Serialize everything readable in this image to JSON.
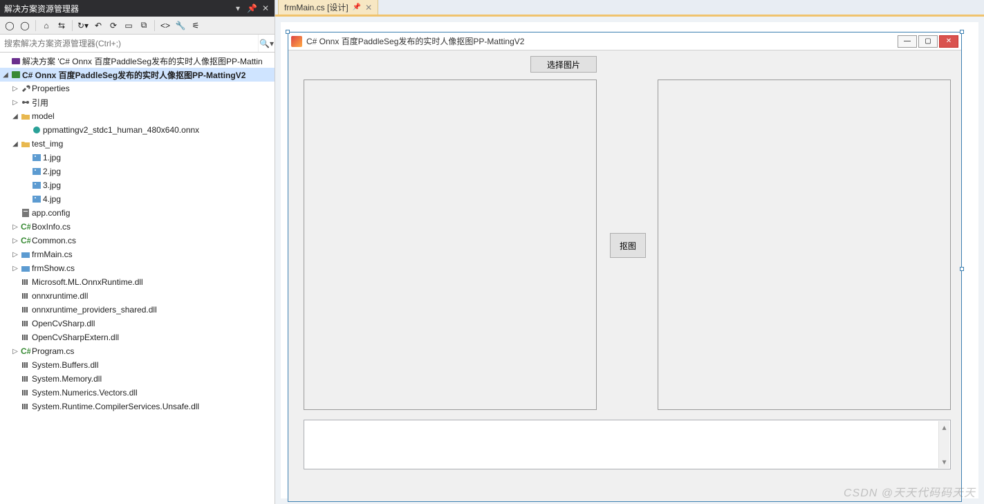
{
  "panel": {
    "title": "解决方案资源管理器",
    "search_placeholder": "搜索解决方案资源管理器(Ctrl+;)"
  },
  "tree": {
    "solution": "解决方案 'C# Onnx 百度PaddleSeg发布的实时人像抠图PP-Mattin",
    "project": "C# Onnx 百度PaddleSeg发布的实时人像抠图PP-MattingV2",
    "properties": "Properties",
    "references": "引用",
    "folder_model": "model",
    "onnx_file": "ppmattingv2_stdc1_human_480x640.onnx",
    "folder_testimg": "test_img",
    "img1": "1.jpg",
    "img2": "2.jpg",
    "img3": "3.jpg",
    "img4": "4.jpg",
    "appconfig": "app.config",
    "boxinfo": "BoxInfo.cs",
    "common": "Common.cs",
    "frmmain": "frmMain.cs",
    "frmshow": "frmShow.cs",
    "dll1": "Microsoft.ML.OnnxRuntime.dll",
    "dll2": "onnxruntime.dll",
    "dll3": "onnxruntime_providers_shared.dll",
    "dll4": "OpenCvSharp.dll",
    "dll5": "OpenCvSharpExtern.dll",
    "program": "Program.cs",
    "dll6": "System.Buffers.dll",
    "dll7": "System.Memory.dll",
    "dll8": "System.Numerics.Vectors.dll",
    "dll9": "System.Runtime.CompilerServices.Unsafe.dll"
  },
  "tab": {
    "label": "frmMain.cs [设计]"
  },
  "form": {
    "title": "C# Onnx 百度PaddleSeg发布的实时人像抠图PP-MattingV2",
    "btn_select": "选择图片",
    "btn_matting": "抠图"
  },
  "watermark": "CSDN @天天代码码天天"
}
